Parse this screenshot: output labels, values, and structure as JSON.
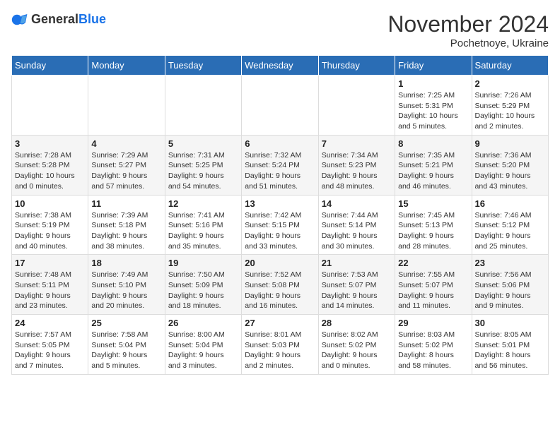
{
  "header": {
    "logo_line1": "General",
    "logo_line2": "Blue",
    "month_title": "November 2024",
    "subtitle": "Pochetnoye, Ukraine"
  },
  "weekdays": [
    "Sunday",
    "Monday",
    "Tuesday",
    "Wednesday",
    "Thursday",
    "Friday",
    "Saturday"
  ],
  "weeks": [
    [
      {
        "day": "",
        "info": ""
      },
      {
        "day": "",
        "info": ""
      },
      {
        "day": "",
        "info": ""
      },
      {
        "day": "",
        "info": ""
      },
      {
        "day": "",
        "info": ""
      },
      {
        "day": "1",
        "info": "Sunrise: 7:25 AM\nSunset: 5:31 PM\nDaylight: 10 hours\nand 5 minutes."
      },
      {
        "day": "2",
        "info": "Sunrise: 7:26 AM\nSunset: 5:29 PM\nDaylight: 10 hours\nand 2 minutes."
      }
    ],
    [
      {
        "day": "3",
        "info": "Sunrise: 7:28 AM\nSunset: 5:28 PM\nDaylight: 10 hours\nand 0 minutes."
      },
      {
        "day": "4",
        "info": "Sunrise: 7:29 AM\nSunset: 5:27 PM\nDaylight: 9 hours\nand 57 minutes."
      },
      {
        "day": "5",
        "info": "Sunrise: 7:31 AM\nSunset: 5:25 PM\nDaylight: 9 hours\nand 54 minutes."
      },
      {
        "day": "6",
        "info": "Sunrise: 7:32 AM\nSunset: 5:24 PM\nDaylight: 9 hours\nand 51 minutes."
      },
      {
        "day": "7",
        "info": "Sunrise: 7:34 AM\nSunset: 5:23 PM\nDaylight: 9 hours\nand 48 minutes."
      },
      {
        "day": "8",
        "info": "Sunrise: 7:35 AM\nSunset: 5:21 PM\nDaylight: 9 hours\nand 46 minutes."
      },
      {
        "day": "9",
        "info": "Sunrise: 7:36 AM\nSunset: 5:20 PM\nDaylight: 9 hours\nand 43 minutes."
      }
    ],
    [
      {
        "day": "10",
        "info": "Sunrise: 7:38 AM\nSunset: 5:19 PM\nDaylight: 9 hours\nand 40 minutes."
      },
      {
        "day": "11",
        "info": "Sunrise: 7:39 AM\nSunset: 5:18 PM\nDaylight: 9 hours\nand 38 minutes."
      },
      {
        "day": "12",
        "info": "Sunrise: 7:41 AM\nSunset: 5:16 PM\nDaylight: 9 hours\nand 35 minutes."
      },
      {
        "day": "13",
        "info": "Sunrise: 7:42 AM\nSunset: 5:15 PM\nDaylight: 9 hours\nand 33 minutes."
      },
      {
        "day": "14",
        "info": "Sunrise: 7:44 AM\nSunset: 5:14 PM\nDaylight: 9 hours\nand 30 minutes."
      },
      {
        "day": "15",
        "info": "Sunrise: 7:45 AM\nSunset: 5:13 PM\nDaylight: 9 hours\nand 28 minutes."
      },
      {
        "day": "16",
        "info": "Sunrise: 7:46 AM\nSunset: 5:12 PM\nDaylight: 9 hours\nand 25 minutes."
      }
    ],
    [
      {
        "day": "17",
        "info": "Sunrise: 7:48 AM\nSunset: 5:11 PM\nDaylight: 9 hours\nand 23 minutes."
      },
      {
        "day": "18",
        "info": "Sunrise: 7:49 AM\nSunset: 5:10 PM\nDaylight: 9 hours\nand 20 minutes."
      },
      {
        "day": "19",
        "info": "Sunrise: 7:50 AM\nSunset: 5:09 PM\nDaylight: 9 hours\nand 18 minutes."
      },
      {
        "day": "20",
        "info": "Sunrise: 7:52 AM\nSunset: 5:08 PM\nDaylight: 9 hours\nand 16 minutes."
      },
      {
        "day": "21",
        "info": "Sunrise: 7:53 AM\nSunset: 5:07 PM\nDaylight: 9 hours\nand 14 minutes."
      },
      {
        "day": "22",
        "info": "Sunrise: 7:55 AM\nSunset: 5:07 PM\nDaylight: 9 hours\nand 11 minutes."
      },
      {
        "day": "23",
        "info": "Sunrise: 7:56 AM\nSunset: 5:06 PM\nDaylight: 9 hours\nand 9 minutes."
      }
    ],
    [
      {
        "day": "24",
        "info": "Sunrise: 7:57 AM\nSunset: 5:05 PM\nDaylight: 9 hours\nand 7 minutes."
      },
      {
        "day": "25",
        "info": "Sunrise: 7:58 AM\nSunset: 5:04 PM\nDaylight: 9 hours\nand 5 minutes."
      },
      {
        "day": "26",
        "info": "Sunrise: 8:00 AM\nSunset: 5:04 PM\nDaylight: 9 hours\nand 3 minutes."
      },
      {
        "day": "27",
        "info": "Sunrise: 8:01 AM\nSunset: 5:03 PM\nDaylight: 9 hours\nand 2 minutes."
      },
      {
        "day": "28",
        "info": "Sunrise: 8:02 AM\nSunset: 5:02 PM\nDaylight: 9 hours\nand 0 minutes."
      },
      {
        "day": "29",
        "info": "Sunrise: 8:03 AM\nSunset: 5:02 PM\nDaylight: 8 hours\nand 58 minutes."
      },
      {
        "day": "30",
        "info": "Sunrise: 8:05 AM\nSunset: 5:01 PM\nDaylight: 8 hours\nand 56 minutes."
      }
    ]
  ]
}
